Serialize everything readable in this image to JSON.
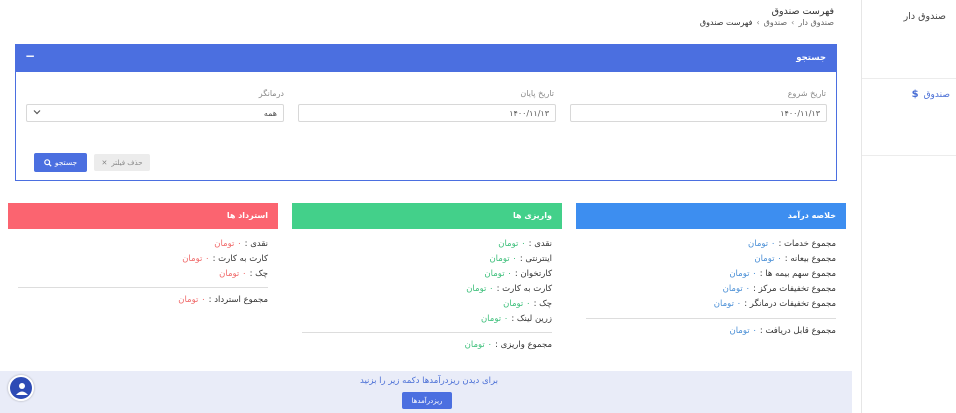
{
  "sidebar": {
    "title": "صندوق دار",
    "items": [
      {
        "icon": "dollar-icon",
        "label": "صندوق"
      }
    ]
  },
  "header": {
    "title": "فهرست صندوق",
    "breadcrumbs": [
      "صندوق دار",
      "صندوق",
      "فهرست صندوق"
    ]
  },
  "search_panel": {
    "title": "جستجو",
    "collapse_label": "−",
    "start_date": {
      "label": "تاریخ شروع",
      "value": "۱۴۰۰/۱۱/۱۳"
    },
    "end_date": {
      "label": "تاریخ پایان",
      "value": "۱۴۰۰/۱۱/۱۳"
    },
    "therapist": {
      "label": "درمانگر",
      "value": "همه"
    },
    "search_button": "جستجو",
    "clear_button": "حذف فیلتر"
  },
  "income_summary": {
    "title": "خلاصه درآمد",
    "rows": [
      {
        "label": "مجموع خدمات :",
        "value": "۰ تومان"
      },
      {
        "label": "مجموع بیعانه :",
        "value": "۰ تومان"
      },
      {
        "label": "مجموع سهم بیمه ها :",
        "value": "۰ تومان"
      },
      {
        "label": "مجموع تخفیفات مرکز :",
        "value": "۰ تومان"
      },
      {
        "label": "مجموع تخفیفات درمانگر :",
        "value": "۰ تومان"
      }
    ],
    "total": {
      "label": "مجموع قابل دریافت :",
      "value": "۰ تومان"
    },
    "color": "#3d8ef0"
  },
  "deposits": {
    "title": "واریزی ها",
    "rows": [
      {
        "label": "نقدی :",
        "value": "۰ تومان"
      },
      {
        "label": "اینترنتی :",
        "value": "۰ تومان"
      },
      {
        "label": "کارتخوان :",
        "value": "۰ تومان"
      },
      {
        "label": "کارت به کارت :",
        "value": "۰ تومان"
      },
      {
        "label": "چک :",
        "value": "۰ تومان"
      },
      {
        "label": "زرین لینک :",
        "value": "۰ تومان"
      }
    ],
    "total": {
      "label": "مجموع واریزی :",
      "value": "۰ تومان"
    },
    "color": "#43d08a"
  },
  "refunds": {
    "title": "استرداد ها",
    "rows": [
      {
        "label": "نقدی :",
        "value": "۰ تومان"
      },
      {
        "label": "کارت به کارت :",
        "value": "۰ تومان"
      },
      {
        "label": "چک :",
        "value": "۰ تومان"
      }
    ],
    "total": {
      "label": "مجموع استرداد :",
      "value": "۰ تومان"
    },
    "color": "#fb6470"
  },
  "bottom_bar": {
    "text": "برای دیدن ریزدرآمدها دکمه زیر را بزنید",
    "button": "ریزدرآمدها"
  }
}
